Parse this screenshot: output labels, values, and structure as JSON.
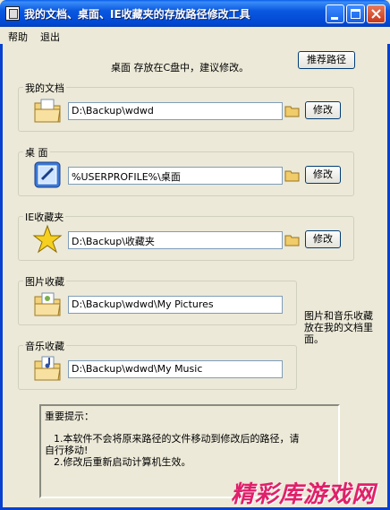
{
  "window": {
    "title": "我的文档、桌面、IE收藏夹的存放路径修改工具"
  },
  "menu": {
    "items": [
      "帮助",
      "退出"
    ]
  },
  "hint": "桌面 存放在C盘中，建议修改。",
  "recommend_button": "推荐路径",
  "groups": [
    {
      "label": "我的文档",
      "path": "D:\\Backup\\wdwd",
      "modify": "修改"
    },
    {
      "label": "桌 面",
      "path": "%USERPROFILE%\\桌面",
      "modify": "修改"
    },
    {
      "label": "IE收藏夹",
      "path": "D:\\Backup\\收藏夹",
      "modify": "修改"
    },
    {
      "label": "图片收藏",
      "path": "D:\\Backup\\wdwd\\My Pictures"
    },
    {
      "label": "音乐收藏",
      "path": "D:\\Backup\\wdwd\\My Music"
    }
  ],
  "side_note": "图片和音乐收藏放在我的文档里面。",
  "notice": {
    "title": "重要提示：",
    "line1": "1.本软件不会将原来路径的文件移动到修改后的路径，请",
    "line1b": "自行移动!",
    "line2": "2.修改后重新启动计算机生效。"
  },
  "watermark": "精彩库游戏网",
  "colors": {
    "titlebar": "#0a58e0",
    "frame": "#0841d0",
    "face": "#ece9d8"
  }
}
